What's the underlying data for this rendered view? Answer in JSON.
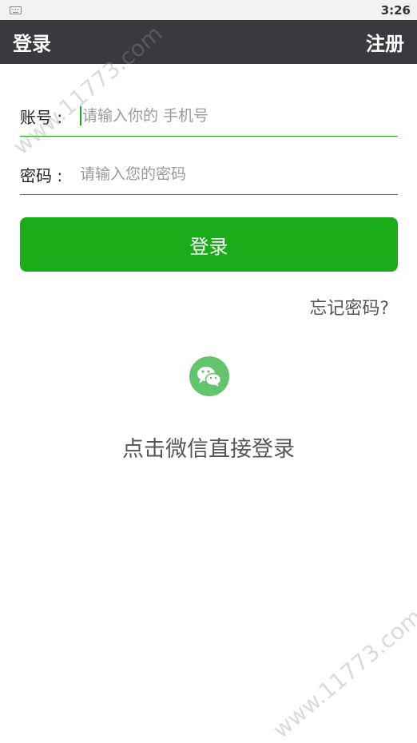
{
  "status_bar": {
    "time": "3:26"
  },
  "header": {
    "title": "登录",
    "register": "注册"
  },
  "form": {
    "account_label": "账号 :",
    "account_placeholder": "请输入你的 手机号",
    "password_label": "密码 :",
    "password_placeholder": "请输入您的密码",
    "login_button": "登录",
    "forgot_password": "忘记密码?"
  },
  "wechat": {
    "icon": "wechat-icon",
    "text": "点击微信直接登录"
  },
  "watermark": "www.11773.com",
  "colors": {
    "primary_green": "#1aad19",
    "app_bar": "#393a3f",
    "wechat_green": "#62c46c"
  }
}
